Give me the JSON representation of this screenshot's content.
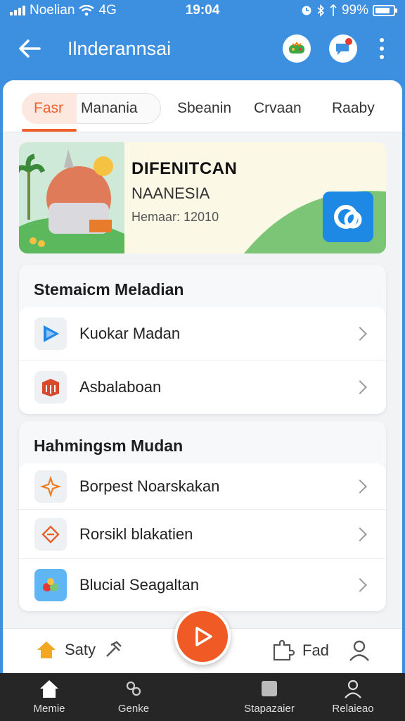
{
  "status_bar": {
    "carrier": "Noelian",
    "network": "4G",
    "time": "19:04",
    "battery": "99%"
  },
  "app_bar": {
    "title": "Ilnderannsai"
  },
  "tabs": [
    {
      "label": "Fasr",
      "active": true
    },
    {
      "label": "Manania",
      "active": false
    },
    {
      "label": "Sbeanin",
      "active": false
    },
    {
      "label": "Crvaan",
      "active": false
    },
    {
      "label": "Raaby",
      "active": false
    }
  ],
  "banner": {
    "title": "DIFENITCAN",
    "subtitle": "NAANESIA",
    "meta": "Hemaar: 12010"
  },
  "section1": {
    "title": "Stemaicm Meladian",
    "items": [
      {
        "label": "Kuokar Madan",
        "icon": "play-store-icon"
      },
      {
        "label": "Asbalaboan",
        "icon": "cube-icon"
      }
    ]
  },
  "section2": {
    "title": "Hahmingsm Mudan",
    "items": [
      {
        "label": "Borpest Noarskakan",
        "icon": "spark-icon"
      },
      {
        "label": "Rorsikl blakatien",
        "icon": "ticket-icon"
      },
      {
        "label": "Blucial Seagaltan",
        "icon": "fruit-icon"
      }
    ]
  },
  "action_bar": {
    "left_label": "Saty",
    "right_label": "Fad"
  },
  "bottom_nav": [
    {
      "label": "Memie",
      "icon": "home-icon"
    },
    {
      "label": "Genke",
      "icon": "link-icon"
    },
    {
      "label": "Stapazaier",
      "icon": "square-icon"
    },
    {
      "label": "Relaieao",
      "icon": "user-icon"
    }
  ],
  "colors": {
    "primary": "#3d8fe0",
    "accent": "#f05a24",
    "nav_bg": "#262626"
  }
}
